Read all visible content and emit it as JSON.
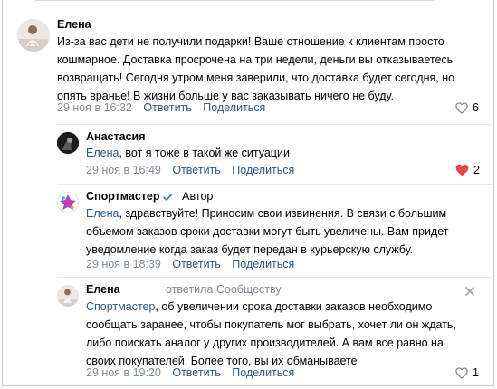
{
  "comments": [
    {
      "author": "Елена",
      "text": "Из-за вас дети не получили подарки! Ваше отношение к клиентам просто кошмарное. Доставка просрочена на три недели, деньги вы отказываетесь возвращать! Сегодня утром меня заверили, что доставка будет сегодня, но опять вранье! В жизни больше у вас заказывать ничего не буду.",
      "lines": [
        "Из-за вас дети не получили подарки! Ваше отношение к клиентам просто",
        "кошмарное. Доставка просрочена на три недели, деньги вы отказываетесь",
        "возвращать! Сегодня утром меня заверили, что доставка будет сегодня, но",
        "опять вранье! В жизни больше у вас заказывать ничего не буду."
      ],
      "time": "29 ноя в 16:32",
      "reply": "Ответить",
      "share": "Поделиться",
      "likes": "6"
    },
    {
      "author": "Анастасия",
      "mention": "Елена",
      "lines_rest": [
        ", вот я тоже в такой же ситуации"
      ],
      "time": "29 ноя в 16:49",
      "reply": "Ответить",
      "share": "Поделиться",
      "likes": "2"
    },
    {
      "author": "Спортмастер",
      "author_tag": "· Автор",
      "mention": "Елена",
      "first_rest": ", здравствуйте! Приносим свои извинения. В связи с большим",
      "lines_more": [
        "объемом заказов сроки доставки могут быть увеличены. Вам придет",
        "уведомление когда заказ будет передан в курьерскую службу."
      ],
      "time": "29 ноя в 18:39",
      "reply": "Ответить",
      "share": "Поделиться"
    },
    {
      "author": "Елена",
      "reply_to": "ответила Сообществу",
      "mention": "Спортмастер",
      "first_rest": ", об увеличении срока доставки заказов необходимо",
      "lines_more": [
        "сообщать заранее, чтобы покупатель мог выбрать, хочет ли он ждать,",
        "либо поискать аналог у других производителей. А вам все равно на",
        "своих покупателей. Более того, вы их обманываете"
      ],
      "time": "29 ноя в 19:20",
      "reply": "Ответить",
      "share": "Поделиться",
      "likes": "1"
    }
  ],
  "icons": [
    "heart-outline-icon",
    "heart-filled-icon",
    "verified-check-icon",
    "close-icon"
  ],
  "colors": {
    "link": "#2a5885",
    "meta": "#818c99",
    "heart_red": "#e64646",
    "verified": "#5181b8"
  }
}
